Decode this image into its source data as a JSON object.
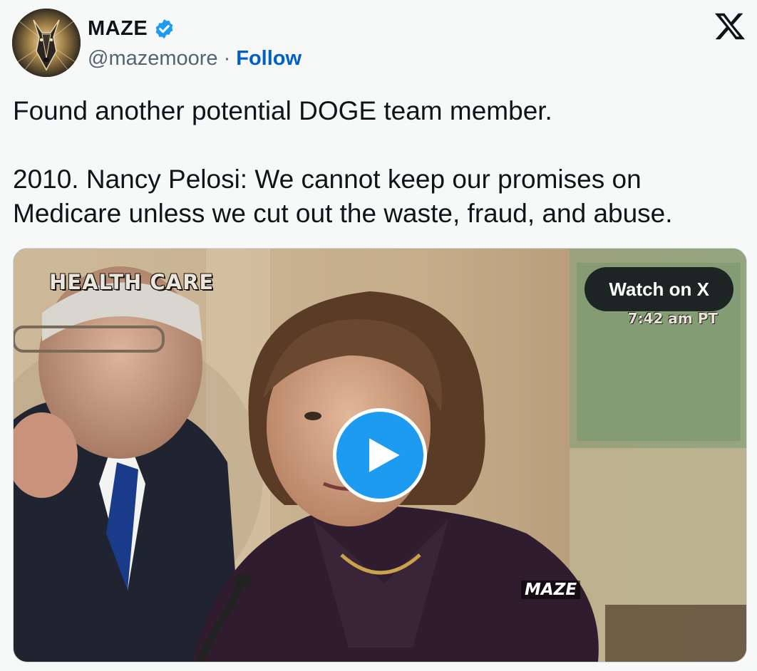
{
  "author": {
    "display_name": "MAZE",
    "handle": "@mazemoore",
    "separator": "·",
    "follow_label": "Follow",
    "verified": true,
    "verified_color": "#1d9bf0",
    "avatar_icon": "doberman-avatar-icon"
  },
  "platform_icon": "x-logo-icon",
  "tweet": {
    "paragraphs": [
      "Found another potential DOGE team member.",
      "2010. Nancy Pelosi: We cannot keep our promises on Medicare unless we cut out the waste, fraud, and abuse."
    ]
  },
  "media": {
    "type": "video",
    "overlay_caption": "HEALTH CARE",
    "broadcast_time": "7:42 am PT",
    "watch_label": "Watch on X",
    "watermark": "MAZE",
    "play_icon": "play-icon",
    "accent_color": "#1d9bf0"
  },
  "colors": {
    "follow_link": "#0060c7",
    "secondary_text": "#536471",
    "background": "#f7f9f9"
  }
}
